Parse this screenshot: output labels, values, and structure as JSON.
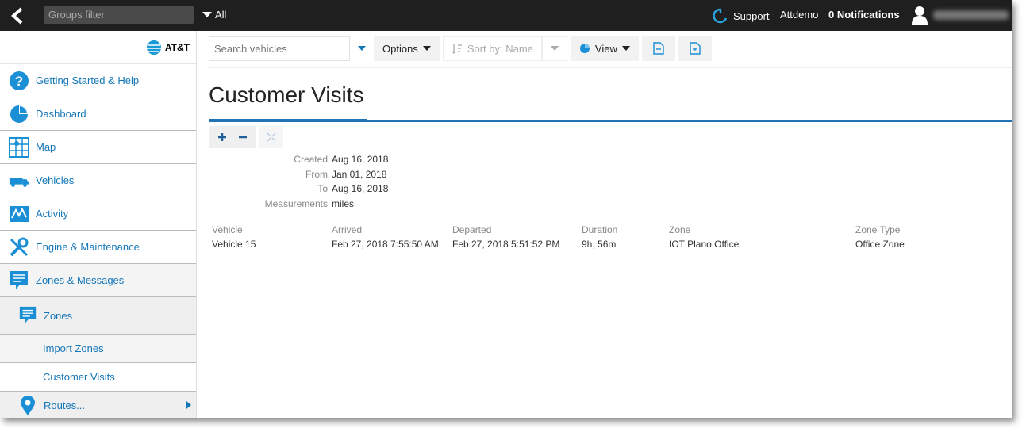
{
  "topbar": {
    "groups_filter_placeholder": "Groups filter",
    "all_label": "All",
    "support_label": "Support",
    "account_label": "Attdemo",
    "notifications_label": "0 Notifications"
  },
  "sidebar": {
    "logo_text": "AT&T",
    "items": [
      {
        "label": "Getting Started & Help",
        "icon": "help-icon"
      },
      {
        "label": "Dashboard",
        "icon": "pie-chart-icon"
      },
      {
        "label": "Map",
        "icon": "map-icon"
      },
      {
        "label": "Vehicles",
        "icon": "truck-icon"
      },
      {
        "label": "Activity",
        "icon": "activity-chart-icon"
      },
      {
        "label": "Engine & Maintenance",
        "icon": "wrench-icon"
      },
      {
        "label": "Zones & Messages",
        "icon": "message-icon"
      }
    ],
    "sub": {
      "zones": "Zones",
      "import_zones": "Import Zones",
      "customer_visits": "Customer Visits",
      "routes": "Routes..."
    }
  },
  "toolbar": {
    "search_placeholder": "Search vehicles",
    "options_label": "Options",
    "sort_label": "Sort by: Name",
    "view_label": "View"
  },
  "page": {
    "title": "Customer Visits"
  },
  "meta": [
    {
      "label": "Created",
      "value": "Aug 16, 2018"
    },
    {
      "label": "From",
      "value": "Jan 01, 2018"
    },
    {
      "label": "To",
      "value": "Aug 16, 2018"
    },
    {
      "label": "Measurements",
      "value": "miles"
    }
  ],
  "table": {
    "headers": [
      "Vehicle",
      "Arrived",
      "Departed",
      "Duration",
      "Zone",
      "Zone Type"
    ],
    "rows": [
      [
        "Vehicle 15",
        "Feb 27, 2018 7:55:50 AM",
        "Feb 27, 2018 5:51:52 PM",
        "9h, 56m",
        "IOT Plano Office",
        "Office Zone"
      ]
    ]
  },
  "colors": {
    "accent": "#1477b8",
    "topbar": "#1f1f1f",
    "title_rule": "#1f73b7"
  }
}
